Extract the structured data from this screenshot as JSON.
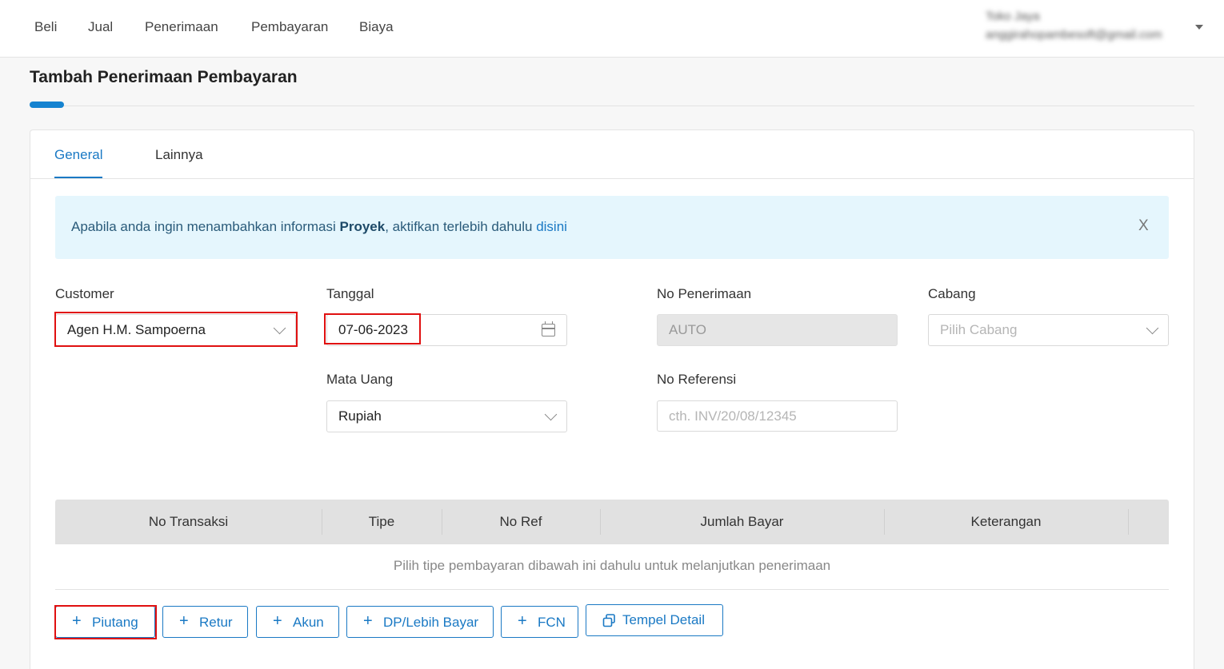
{
  "nav": {
    "items": [
      "Beli",
      "Jual",
      "Penerimaan",
      "Pembayaran",
      "Biaya"
    ],
    "user_name": "Toko Jaya",
    "user_email": "anggirahopambesoft@gmail.com"
  },
  "page": {
    "title": "Tambah Penerimaan Pembayaran"
  },
  "tabs": [
    {
      "label": "General",
      "active": true
    },
    {
      "label": "Lainnya",
      "active": false
    }
  ],
  "alert": {
    "text_before": "Apabila anda ingin menambahkan informasi ",
    "bold": "Proyek",
    "text_after": ", aktifkan terlebih dahulu ",
    "link": "disini",
    "close": "X"
  },
  "form": {
    "customer": {
      "label": "Customer",
      "value": "Agen H.M. Sampoerna"
    },
    "tanggal": {
      "label": "Tanggal",
      "value": "07-06-2023"
    },
    "no_penerimaan": {
      "label": "No Penerimaan",
      "value": "AUTO"
    },
    "cabang": {
      "label": "Cabang",
      "placeholder": "Pilih Cabang"
    },
    "mata_uang": {
      "label": "Mata Uang",
      "value": "Rupiah"
    },
    "no_referensi": {
      "label": "No Referensi",
      "placeholder": "cth. INV/20/08/12345"
    }
  },
  "table": {
    "columns": [
      "No Transaksi",
      "Tipe",
      "No Ref",
      "Jumlah Bayar",
      "Keterangan"
    ],
    "empty_message": "Pilih tipe pembayaran dibawah ini dahulu untuk melanjutkan penerimaan"
  },
  "buttons": {
    "piutang": "Piutang",
    "retur": "Retur",
    "akun": "Akun",
    "dp": "DP/Lebih Bayar",
    "fcn": "FCN",
    "tempel": "Tempel Detail"
  },
  "colors": {
    "primary": "#1a79c4",
    "highlight": "#e01010",
    "alert_bg": "#e5f6fd"
  }
}
